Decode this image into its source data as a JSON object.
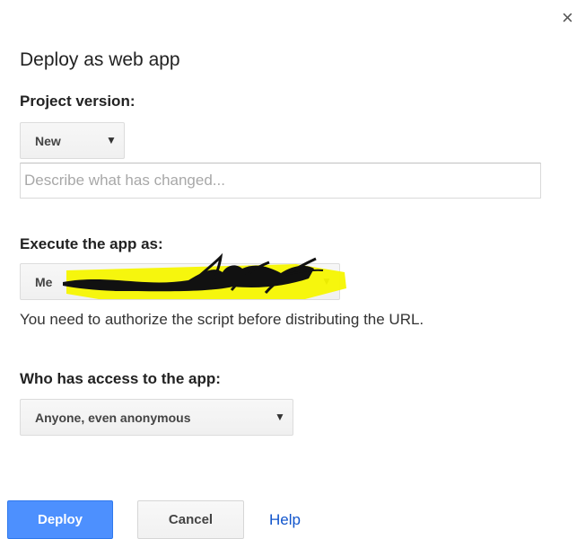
{
  "dialog": {
    "title": "Deploy as web app",
    "close_icon": "close-icon"
  },
  "project_version": {
    "label": "Project version:",
    "selected": "New",
    "description_placeholder": "Describe what has changed...",
    "description_value": ""
  },
  "execute_as": {
    "label": "Execute the app as:",
    "selected_visible_prefix": "Me",
    "redaction_highlight_color": "#f5f500",
    "redaction_scribble_color": "#111111",
    "note": "You need to authorize the script before distributing the URL."
  },
  "access": {
    "label": "Who has access to the app:",
    "selected": "Anyone, even anonymous"
  },
  "footer": {
    "deploy_label": "Deploy",
    "cancel_label": "Cancel",
    "help_label": "Help"
  },
  "colors": {
    "primary": "#4d90fe",
    "link": "#1155cc"
  }
}
